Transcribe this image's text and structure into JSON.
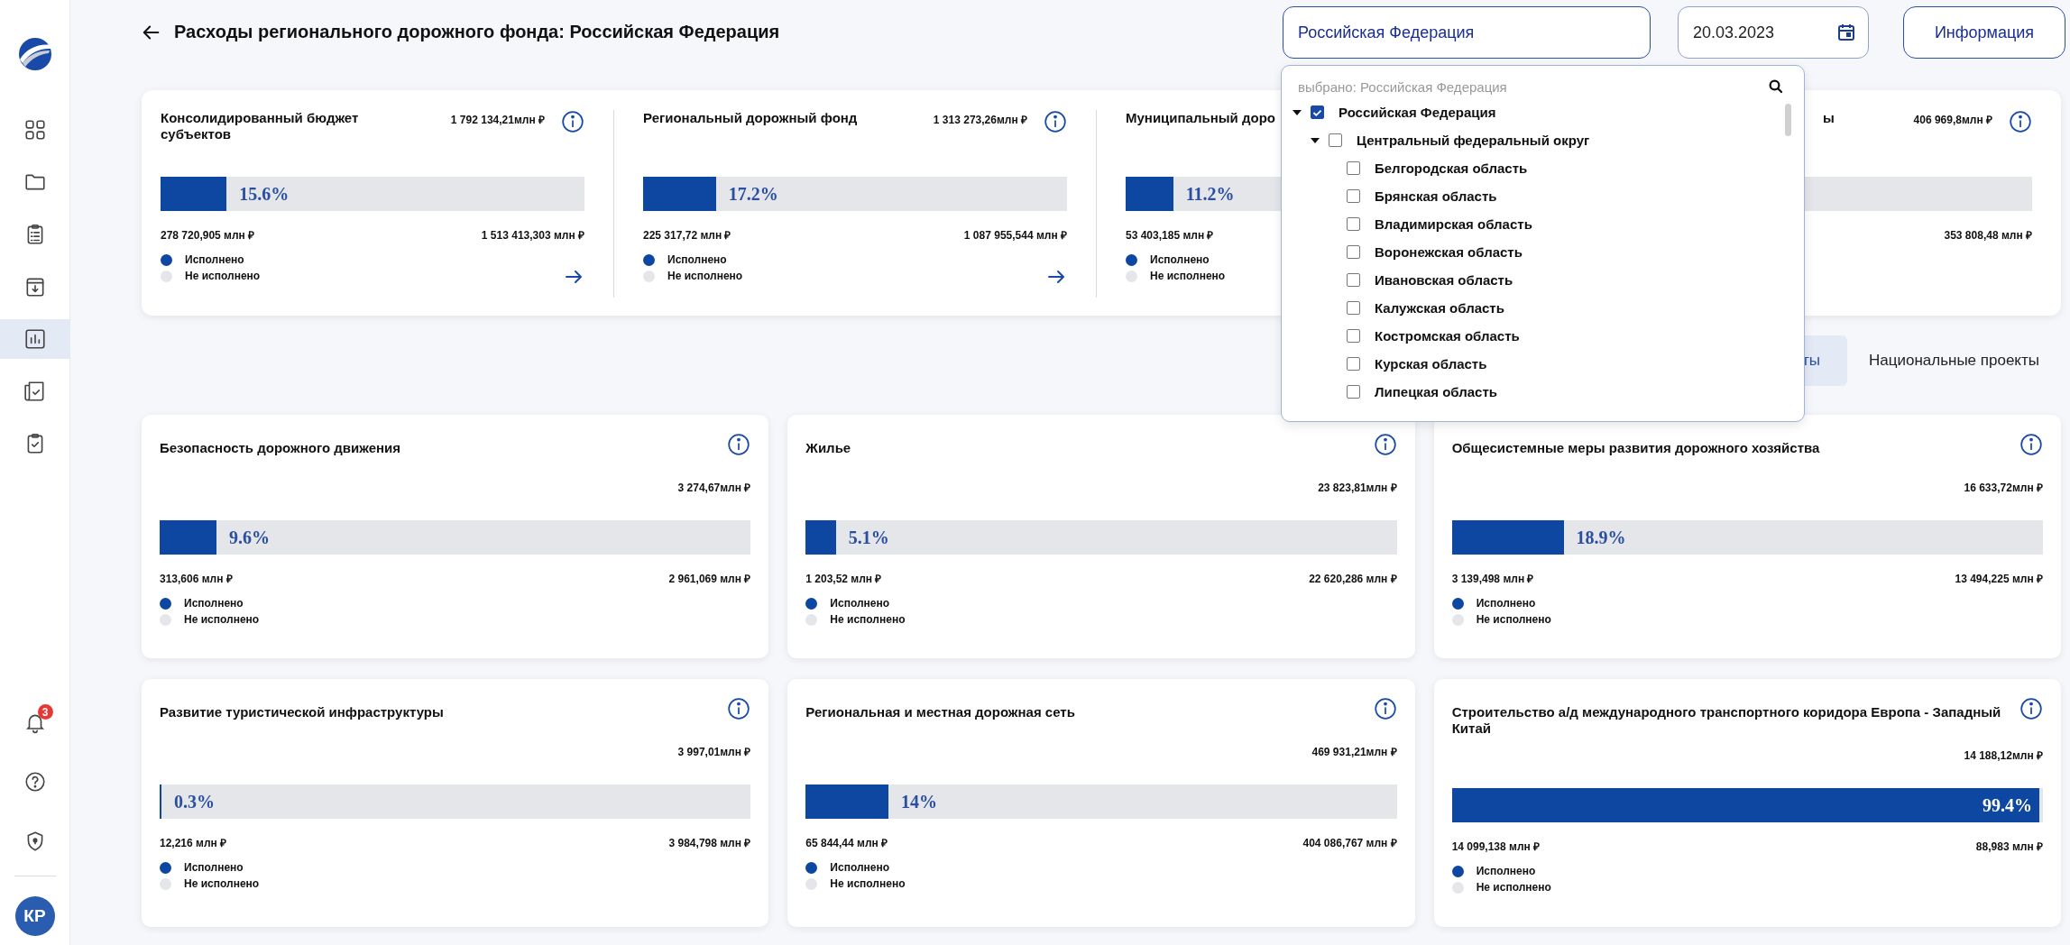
{
  "sidebar": {
    "items": [
      {
        "selected": false
      },
      {
        "selected": false
      },
      {
        "selected": false
      },
      {
        "selected": false
      },
      {
        "selected": true
      },
      {
        "selected": false
      },
      {
        "selected": false
      }
    ],
    "notifications_badge": "3",
    "avatar": "КР"
  },
  "header": {
    "title": "Расходы регионального дорожного фонда: Российская Федерация",
    "region_field": {
      "value": "Российская Федерация"
    },
    "date_field": {
      "value": "20.03.2023"
    },
    "info_button": "Информация"
  },
  "summary": [
    {
      "title": "Консолидированный бюджет субъектов",
      "total": "1 792 134,21млн ₽",
      "info": true,
      "level": 0.156,
      "percent": "15.6%",
      "left": "278 720,905 млн ₽",
      "right": "1 513 413,303 млн ₽",
      "legend": [
        {
          "label": "Исполнено",
          "color": "#0d47a1"
        },
        {
          "label": "Не исполнено",
          "color": "#e4e6ea"
        }
      ],
      "arrow": true
    },
    {
      "title": "Региональный дорожный фонд",
      "total": "1 313 273,26млн ₽",
      "info": true,
      "level": 0.172,
      "percent": "17.2%",
      "left": "225 317,72 млн ₽",
      "right": "1 087 955,544 млн ₽",
      "legend": [
        {
          "label": "Исполнено",
          "color": "#0d47a1"
        },
        {
          "label": "Не исполнено",
          "color": "#e4e6ea"
        }
      ],
      "arrow": true
    },
    {
      "title": "Муниципальный доро",
      "info": false,
      "level": 0.112,
      "percent": "11.2%",
      "left": "53 403,185 млн ₽",
      "legend": [
        {
          "label": "Исполнено",
          "color": "#0d47a1"
        },
        {
          "label": "Не исполнено",
          "color": "#e4e6ea"
        }
      ],
      "arrow": false
    },
    {
      "title": "ы",
      "total": "406 969,8млн ₽",
      "info": true,
      "right": "353 808,48 млн ₽",
      "arrow": false
    }
  ],
  "tabs": [
    {
      "label": "ты",
      "selected": true
    },
    {
      "label": "Национальные проекты",
      "selected": false
    }
  ],
  "cards": [
    {
      "title": "Безопасность дорожного движения",
      "total": "3 274,67млн ₽",
      "level": 0.096,
      "percent": "9.6%",
      "left": "313,606 млн ₽",
      "right": "2 961,069 млн ₽",
      "legend": [
        {
          "label": "Исполнено",
          "color": "#0d47a1"
        },
        {
          "label": "Не исполнено",
          "color": "#e4e6ea"
        }
      ]
    },
    {
      "title": "Жилье",
      "total": "23 823,81млн ₽",
      "level": 0.051,
      "percent": "5.1%",
      "left": "1 203,52 млн ₽",
      "right": "22 620,286 млн ₽",
      "legend": [
        {
          "label": "Исполнено",
          "color": "#0d47a1"
        },
        {
          "label": "Не исполнено",
          "color": "#e4e6ea"
        }
      ]
    },
    {
      "title": "Общесистемные меры развития дорожного хозяйства",
      "total": "16 633,72млн ₽",
      "level": 0.189,
      "percent": "18.9%",
      "left": "3 139,498 млн ₽",
      "right": "13 494,225 млн ₽",
      "legend": [
        {
          "label": "Исполнено",
          "color": "#0d47a1"
        },
        {
          "label": "Не исполнено",
          "color": "#e4e6ea"
        }
      ]
    },
    {
      "title": "Развитие туристической инфраструктуры",
      "total": "3 997,01млн ₽",
      "level": 0.003,
      "percent": "0.3%",
      "left": "12,216 млн ₽",
      "right": "3 984,798 млн ₽",
      "legend": [
        {
          "label": "Исполнено",
          "color": "#0d47a1"
        },
        {
          "label": "Не исполнено",
          "color": "#e4e6ea"
        }
      ]
    },
    {
      "title": "Региональная и местная дорожная сеть",
      "total": "469 931,21млн ₽",
      "level": 0.14,
      "percent": "14%",
      "left": "65 844,44 млн ₽",
      "right": "404 086,767 млн ₽",
      "legend": [
        {
          "label": "Исполнено",
          "color": "#0d47a1"
        },
        {
          "label": "Не исполнено",
          "color": "#e4e6ea"
        }
      ]
    },
    {
      "title": "Строительство а/д международного транспортного коридора Европа - Западный Китай",
      "total": "14 188,12млн ₽",
      "level": 0.994,
      "percent": "99.4%",
      "left": "14 099,138 млн ₽",
      "right": "88,983 млн ₽",
      "legend": [
        {
          "label": "Исполнено",
          "color": "#0d47a1"
        },
        {
          "label": "Не исполнено",
          "color": "#e4e6ea"
        }
      ]
    }
  ],
  "dropdown": {
    "search_placeholder": "выбрано: Российская Федерация",
    "tree": [
      {
        "label": "Российская Федерация",
        "checked": true,
        "expanded": true,
        "children": [
          {
            "label": "Центральный федеральный округ",
            "checked": false,
            "expanded": true,
            "children": [
              {
                "label": "Белгородская область",
                "checked": false
              },
              {
                "label": "Брянская область",
                "checked": false
              },
              {
                "label": "Владимирская область",
                "checked": false
              },
              {
                "label": "Воронежская область",
                "checked": false
              },
              {
                "label": "Ивановская область",
                "checked": false
              },
              {
                "label": "Калужская область",
                "checked": false
              },
              {
                "label": "Костромская область",
                "checked": false
              },
              {
                "label": "Курская область",
                "checked": false
              },
              {
                "label": "Липецкая область",
                "checked": false
              }
            ]
          }
        ]
      }
    ]
  }
}
